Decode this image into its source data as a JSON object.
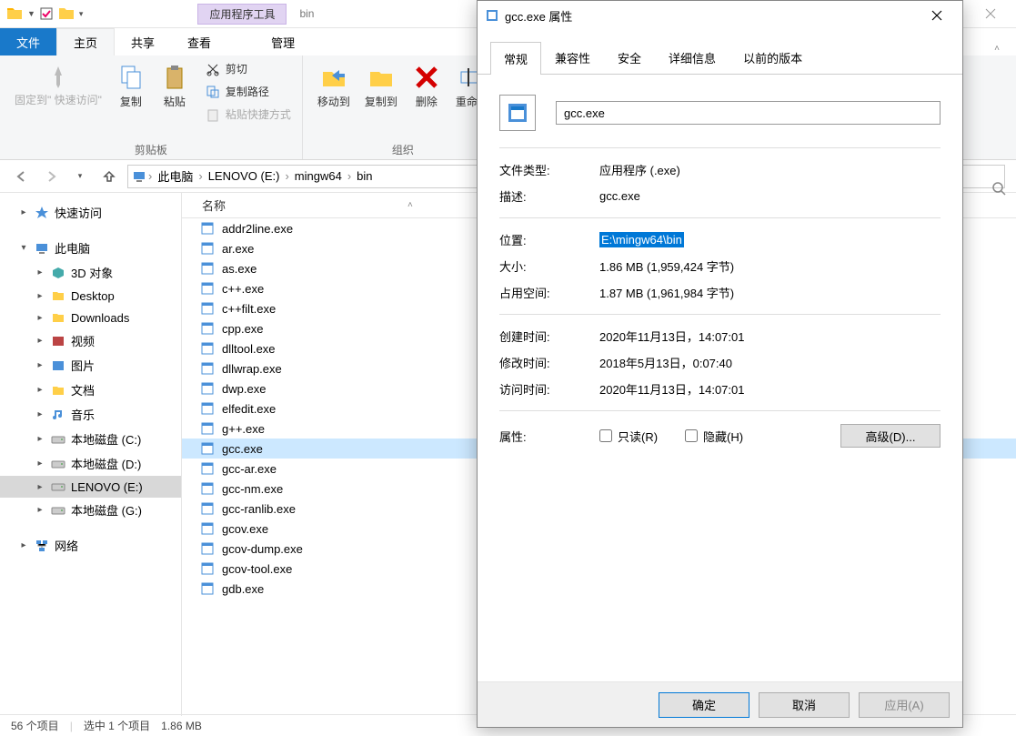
{
  "titlebar": {
    "context_tools": "应用程序工具",
    "window_title": "bin"
  },
  "ribbon_tabs": {
    "file": "文件",
    "home": "主页",
    "share": "共享",
    "view": "查看",
    "manage": "管理"
  },
  "ribbon": {
    "pin_to_quick_access": "固定到\"\n快速访问\"",
    "copy": "复制",
    "paste": "粘贴",
    "cut": "剪切",
    "copy_path": "复制路径",
    "paste_shortcut": "粘贴快捷方式",
    "clipboard_group": "剪贴板",
    "move_to": "移动到",
    "copy_to": "复制到",
    "delete": "删除",
    "rename": "重命名",
    "organize_group": "组织"
  },
  "breadcrumb": {
    "items": [
      "此电脑",
      "LENOVO (E:)",
      "mingw64",
      "bin"
    ]
  },
  "navpane": {
    "quick_access": "快速访问",
    "this_pc": "此电脑",
    "items": [
      {
        "label": "3D 对象"
      },
      {
        "label": "Desktop"
      },
      {
        "label": "Downloads"
      },
      {
        "label": "视频"
      },
      {
        "label": "图片"
      },
      {
        "label": "文档"
      },
      {
        "label": "音乐"
      },
      {
        "label": "本地磁盘 (C:)"
      },
      {
        "label": "本地磁盘 (D:)"
      },
      {
        "label": "LENOVO (E:)"
      },
      {
        "label": "本地磁盘 (G:)"
      }
    ],
    "network": "网络"
  },
  "filelist": {
    "header_name": "名称",
    "files": [
      "addr2line.exe",
      "ar.exe",
      "as.exe",
      "c++.exe",
      "c++filt.exe",
      "cpp.exe",
      "dlltool.exe",
      "dllwrap.exe",
      "dwp.exe",
      "elfedit.exe",
      "g++.exe",
      "gcc.exe",
      "gcc-ar.exe",
      "gcc-nm.exe",
      "gcc-ranlib.exe",
      "gcov.exe",
      "gcov-dump.exe",
      "gcov-tool.exe",
      "gdb.exe"
    ],
    "selected_index": 11
  },
  "statusbar": {
    "count": "56 个项目",
    "selection": "选中 1 个项目",
    "size": "1.86 MB"
  },
  "dialog": {
    "title": "gcc.exe 属性",
    "tabs": {
      "general": "常规",
      "compat": "兼容性",
      "security": "安全",
      "details": "详细信息",
      "previous": "以前的版本"
    },
    "filename": "gcc.exe",
    "type_label": "文件类型:",
    "type_value": "应用程序 (.exe)",
    "desc_label": "描述:",
    "desc_value": "gcc.exe",
    "loc_label": "位置:",
    "loc_value": "E:\\mingw64\\bin",
    "size_label": "大小:",
    "size_value": "1.86 MB (1,959,424 字节)",
    "disk_label": "占用空间:",
    "disk_value": "1.87 MB (1,961,984 字节)",
    "created_label": "创建时间:",
    "created_value": "2020年11月13日，14:07:01",
    "modified_label": "修改时间:",
    "modified_value": "2018年5月13日，0:07:40",
    "accessed_label": "访问时间:",
    "accessed_value": "2020年11月13日，14:07:01",
    "attr_label": "属性:",
    "readonly": "只读(R)",
    "hidden": "隐藏(H)",
    "advanced": "高级(D)...",
    "ok": "确定",
    "cancel": "取消",
    "apply": "应用(A)"
  }
}
